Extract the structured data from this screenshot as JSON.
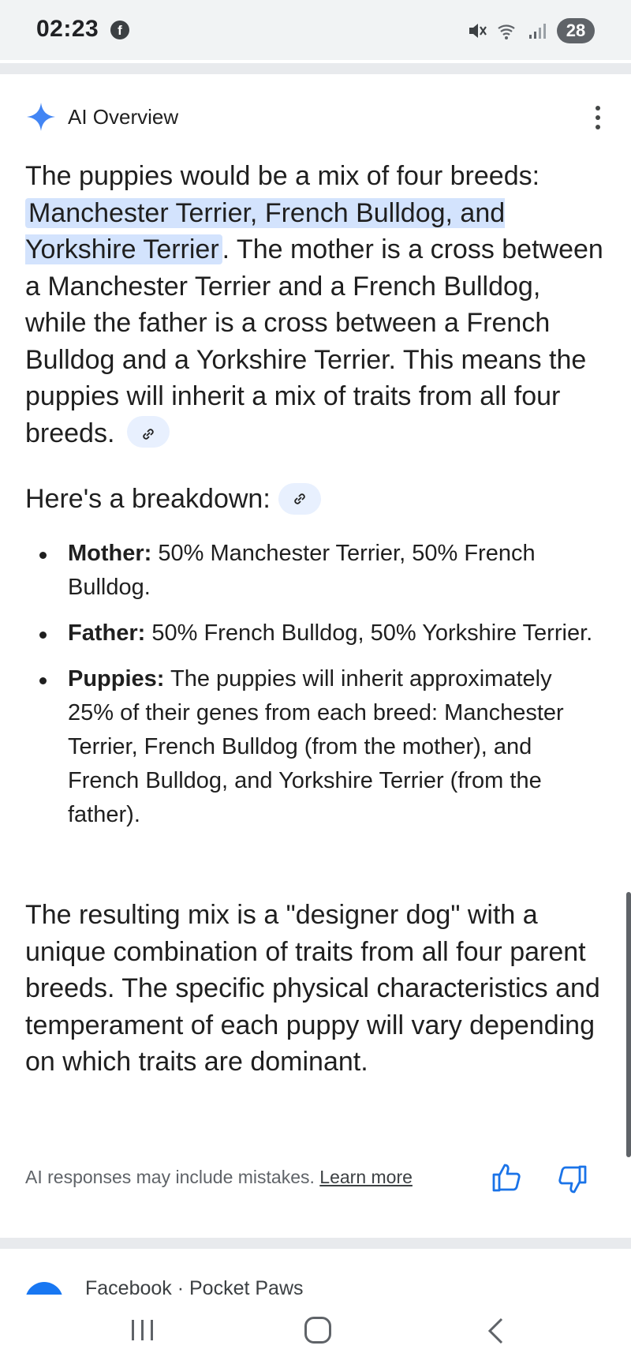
{
  "status_bar": {
    "time": "02:23",
    "notification_icon": "facebook-icon",
    "battery": "28"
  },
  "ai_overview": {
    "title": "AI Overview",
    "intro": {
      "lead": "The puppies would be a mix of four breeds: ",
      "highlight": "Manchester Terrier, French Bulldog, and Yorkshire Terrier",
      "rest": ". The mother is a cross between a Manchester Terrier and a French Bulldog, while the father is a cross between a French Bulldog and a Yorkshire Terrier. This means the puppies will inherit a mix of traits from all four breeds."
    },
    "breakdown_title": "Here's a breakdown:",
    "bullets": [
      {
        "label": "Mother:",
        "text": " 50% Manchester Terrier, 50% French Bulldog."
      },
      {
        "label": "Father:",
        "text": " 50% French Bulldog, 50% Yorkshire Terrier."
      },
      {
        "label": "Puppies:",
        "text": " The puppies will inherit approximately 25% of their genes from each breed: Manchester Terrier, French Bulldog (from the mother), and French Bulldog, and Yorkshire Terrier (from the father)."
      }
    ],
    "conclusion": "The resulting mix is a \"designer dog\" with a unique combination of traits from all four parent breeds. The specific physical characteristics and temperament of each puppy will vary depending on which traits are dominant.",
    "disclaimer": "AI responses may include mistakes. ",
    "learn_more": "Learn more"
  },
  "next_result": {
    "source": "Facebook · Pocket Paws"
  },
  "colors": {
    "highlight": "#d3e3fd",
    "accent_blue": "#1a73e8",
    "gem_blue": "#4285f4"
  }
}
